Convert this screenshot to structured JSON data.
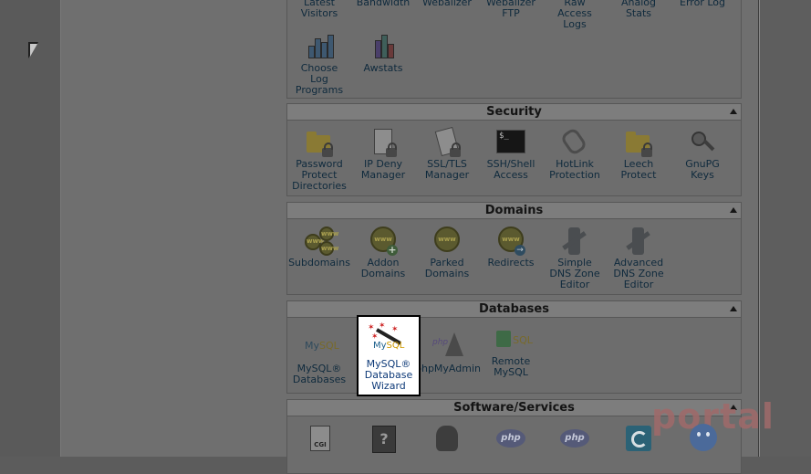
{
  "logs_section": {
    "top_row": [
      "Latest\nVisitors",
      "Bandwidth",
      "Webalizer",
      "Webalizer\nFTP",
      "Raw\nAccess\nLogs",
      "Analog\nStats",
      "Error Log"
    ],
    "bottom_row": [
      {
        "label": "Choose\nLog\nPrograms",
        "icon": "log-programs-icon"
      },
      {
        "label": "Awstats",
        "icon": "awstats-chart-icon"
      }
    ]
  },
  "security": {
    "title": "Security",
    "items": [
      {
        "label": "Password\nProtect\nDirectories",
        "icon": "folder-lock-icon"
      },
      {
        "label": "IP Deny\nManager",
        "icon": "ip-deny-icon"
      },
      {
        "label": "SSL/TLS\nManager",
        "icon": "certificate-icon"
      },
      {
        "label": "SSH/Shell\nAccess",
        "icon": "terminal-icon"
      },
      {
        "label": "HotLink\nProtection",
        "icon": "chain-link-icon"
      },
      {
        "label": "Leech\nProtect",
        "icon": "folder-lock-icon"
      },
      {
        "label": "GnuPG\nKeys",
        "icon": "keys-icon"
      }
    ]
  },
  "domains": {
    "title": "Domains",
    "items": [
      {
        "label": "Subdomains",
        "icon": "www-globes-icon"
      },
      {
        "label": "Addon\nDomains",
        "icon": "www-add-icon"
      },
      {
        "label": "Parked\nDomains",
        "icon": "www-parked-icon"
      },
      {
        "label": "Redirects",
        "icon": "www-redirect-icon"
      },
      {
        "label": "Simple\nDNS Zone\nEditor",
        "icon": "dns-zone-icon"
      },
      {
        "label": "Advanced\nDNS Zone\nEditor",
        "icon": "dns-zone-advanced-icon"
      }
    ]
  },
  "databases": {
    "title": "Databases",
    "items": [
      {
        "label": "MySQL®\nDatabases",
        "icon": "mysql-icon"
      },
      {
        "label": "MySQL®\nDatabase\nWizard",
        "icon": "mysql-wizard-icon"
      },
      {
        "label": "phpMyAdmin",
        "icon": "phpmyadmin-icon"
      },
      {
        "label": "Remote\nMySQL",
        "icon": "remote-mysql-icon"
      }
    ]
  },
  "software": {
    "title": "Software/Services",
    "icons": [
      "cgi-icon",
      "help-book-icon",
      "perl-camel-icon",
      "php-icon",
      "php-icon",
      "blue-app-icon",
      "smiley-icon"
    ]
  },
  "icon_text": {
    "terminal": "$_",
    "www": "www",
    "plus": "+",
    "arrow": "→",
    "php": "php",
    "cgi": "CGI",
    "help": "?",
    "my": "My",
    "sql": "SQL"
  },
  "watermark": "portal",
  "colors": {
    "highlight_border": "#000000",
    "link_text": "#0e3a78",
    "dim_overlay": "#6f6f6f"
  }
}
